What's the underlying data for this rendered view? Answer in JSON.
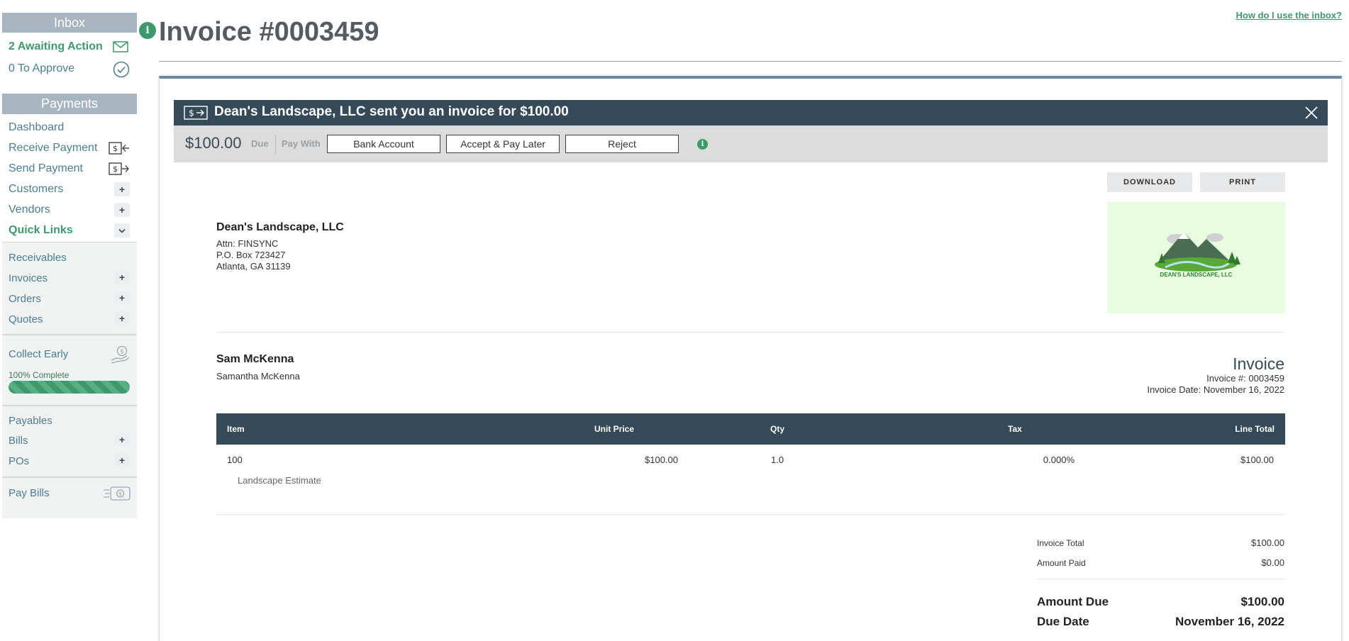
{
  "sidebar": {
    "inbox": {
      "title": "Inbox",
      "awaiting": "2 Awaiting Action",
      "to_approve": "0 To Approve"
    },
    "payments": {
      "title": "Payments",
      "items": {
        "dashboard": "Dashboard",
        "receive": "Receive Payment",
        "send": "Send Payment",
        "customers": "Customers",
        "vendors": "Vendors",
        "quick_links": "Quick Links"
      }
    },
    "quick": {
      "receivables": "Receivables",
      "invoices": "Invoices",
      "orders": "Orders",
      "quotes": "Quotes",
      "collect_early": "Collect Early",
      "complete": "100% Complete",
      "complete_pct": 100,
      "payables": "Payables",
      "bills": "Bills",
      "pos": "POs",
      "pay_bills": "Pay Bills"
    },
    "plus": "+"
  },
  "header": {
    "title": "Invoice #0003459",
    "help": "How do I use the inbox?"
  },
  "banner": {
    "text": "Dean's Landscape, LLC sent you an invoice for $100.00"
  },
  "paybar": {
    "amount": "$100.00",
    "due": "Due",
    "pay_with": "Pay With",
    "bank": "Bank Account",
    "later": "Accept & Pay Later",
    "reject": "Reject"
  },
  "actions": {
    "download": "DOWNLOAD",
    "print": "PRINT"
  },
  "from": {
    "name": "Dean's Landscape, LLC",
    "attn": "Attn: FINSYNC",
    "line1": "P.O. Box 723427",
    "line2": "Atlanta, GA 31139",
    "logo_text": "DEAN'S LANDSCAPE, LLC"
  },
  "to": {
    "name": "Sam McKenna",
    "contact": "Samantha McKenna"
  },
  "invoice": {
    "heading": "Invoice",
    "number": "Invoice #: 0003459",
    "date": "Invoice Date: November 16, 2022"
  },
  "table": {
    "headers": {
      "item": "Item",
      "unit_price": "Unit Price",
      "qty": "Qty",
      "tax": "Tax",
      "line_total": "Line Total"
    },
    "row": {
      "item": "100",
      "description": "Landscape Estimate",
      "unit_price": "$100.00",
      "qty": "1.0",
      "tax": "0.000%",
      "line_total": "$100.00"
    }
  },
  "totals": {
    "invoice_total_label": "Invoice Total",
    "invoice_total": "$100.00",
    "amount_paid_label": "Amount Paid",
    "amount_paid": "$0.00",
    "amount_due_label": "Amount Due",
    "amount_due": "$100.00",
    "due_date_label": "Due Date",
    "due_date": "November 16, 2022"
  },
  "colors": {
    "accent_green": "#3d9a6d",
    "banner_navy": "#354a58",
    "sidebar_head": "#a7b5c1",
    "link_blue": "#4a7e92"
  }
}
